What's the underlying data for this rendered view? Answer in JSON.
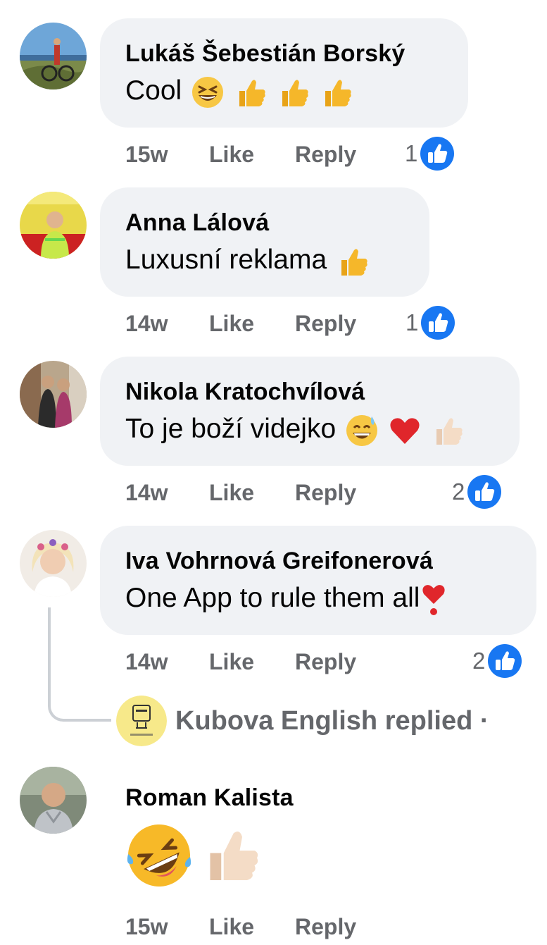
{
  "comments": [
    {
      "author": "Lukáš Šebestián Borský",
      "text": "Cool",
      "emojis": [
        "laughing-face",
        "thumbs-up",
        "thumbs-up",
        "thumbs-up"
      ],
      "timestamp": "15w",
      "like_label": "Like",
      "reply_label": "Reply",
      "reaction_count": "1"
    },
    {
      "author": "Anna Lálová",
      "text": "Luxusní reklama",
      "emojis": [
        "thumbs-up"
      ],
      "timestamp": "14w",
      "like_label": "Like",
      "reply_label": "Reply",
      "reaction_count": "1"
    },
    {
      "author": "Nikola Kratochvílová",
      "text": "To je boží videjko",
      "emojis": [
        "grinning-sweat-face",
        "red-heart",
        "thumbs-up-light"
      ],
      "timestamp": "14w",
      "like_label": "Like",
      "reply_label": "Reply",
      "reaction_count": "2"
    },
    {
      "author": "Iva Vohrnová Greifonerová",
      "text": "One App to rule them all",
      "emojis": [
        "heart-exclamation"
      ],
      "timestamp": "14w",
      "like_label": "Like",
      "reply_label": "Reply",
      "reaction_count": "2",
      "replied_by": "Kubova English replied ·"
    },
    {
      "author": "Roman Kalista",
      "text": "",
      "emojis": [
        "rolling-laughing-face",
        "thumbs-up-light"
      ],
      "timestamp": "15w",
      "like_label": "Like",
      "reply_label": "Reply"
    }
  ],
  "colors": {
    "bubble": "#f0f2f5",
    "meta_text": "#65676b",
    "like_badge": "#1877f2",
    "thread_line": "#ccd0d5"
  }
}
